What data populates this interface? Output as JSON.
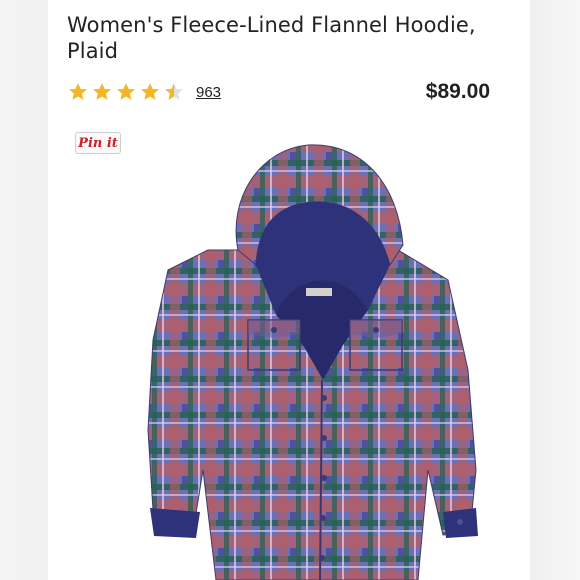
{
  "product": {
    "title": "Women's Fleece-Lined Flannel Hoodie, Plaid",
    "rating_value": 4.5,
    "rating_max": 5,
    "review_count": "963",
    "price": "$89.00",
    "pin_label": "Pin it",
    "image_label": ""
  },
  "colors": {
    "star": "#f5b625",
    "pin_red": "#cb2027",
    "fleece_navy": "#2e327a",
    "plaid_blue": "#5b6fc0",
    "plaid_red": "#b65d63",
    "plaid_green": "#23604f"
  }
}
